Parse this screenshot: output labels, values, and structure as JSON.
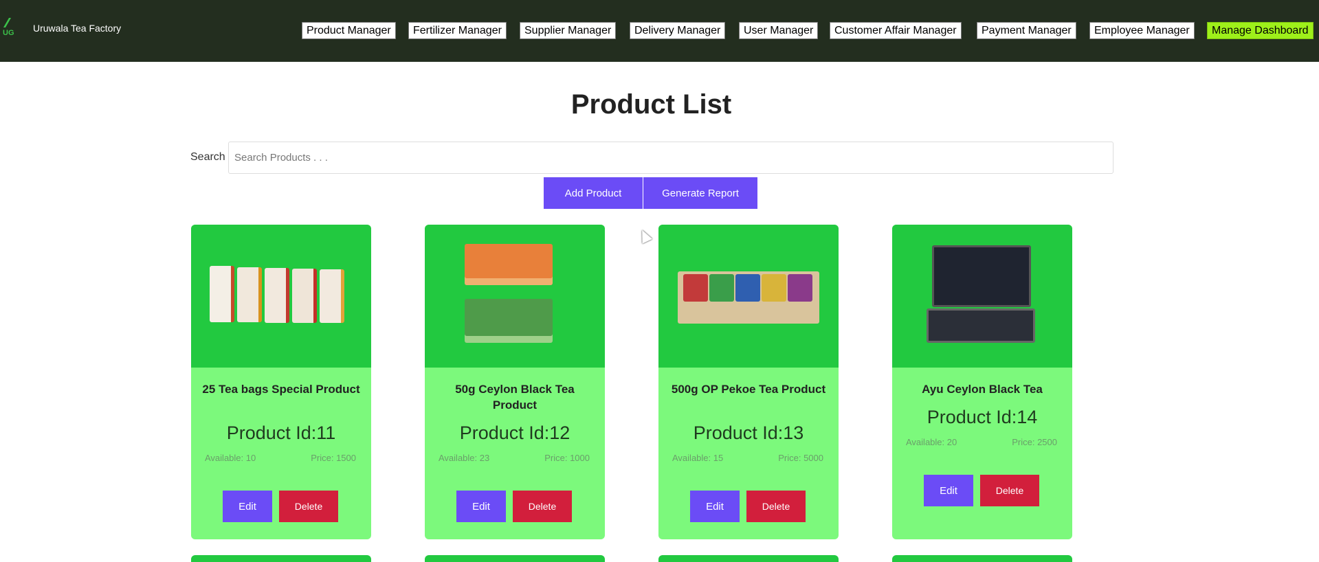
{
  "header": {
    "brand": "Uruwala Tea Factory",
    "logo_text": "UG",
    "nav": [
      {
        "label": "Product Manager"
      },
      {
        "label": "Fertilizer Manager"
      },
      {
        "label": "Supplier Manager"
      },
      {
        "label": "Delivery Manager"
      },
      {
        "label": "User Manager"
      },
      {
        "label": "Customer Affair Manager"
      },
      {
        "label": "Payment Manager"
      },
      {
        "label": "Employee Manager"
      },
      {
        "label": "Manage Dashboard"
      }
    ]
  },
  "main": {
    "title": "Product List",
    "search_label": "Search",
    "search_placeholder": "Search Products . . .",
    "add_label": "Add Product",
    "report_label": "Generate Report"
  },
  "products": [
    {
      "name": "25 Tea bags Special Product",
      "pid": "Product Id:11",
      "available": "Available: 10",
      "price": "Price: 1500",
      "edit": "Edit",
      "delete": "Delete"
    },
    {
      "name": "50g Ceylon Black Tea Product",
      "pid": "Product Id:12",
      "available": "Available: 23",
      "price": "Price: 1000",
      "edit": "Edit",
      "delete": "Delete"
    },
    {
      "name": "500g OP Pekoe Tea Product",
      "pid": "Product Id:13",
      "available": "Available: 15",
      "price": "Price: 5000",
      "edit": "Edit",
      "delete": "Delete"
    },
    {
      "name": "Ayu Ceylon Black Tea",
      "pid": "Product Id:14",
      "available": "Available: 20",
      "price": "Price: 2500",
      "edit": "Edit",
      "delete": "Delete"
    }
  ],
  "colors": {
    "header_bg": "#232e1f",
    "active_nav": "#9ef01a",
    "primary": "#6b4cf6",
    "danger": "#d21f3c",
    "card_bg": "#7cf97c",
    "card_image_bg": "#22c940"
  }
}
